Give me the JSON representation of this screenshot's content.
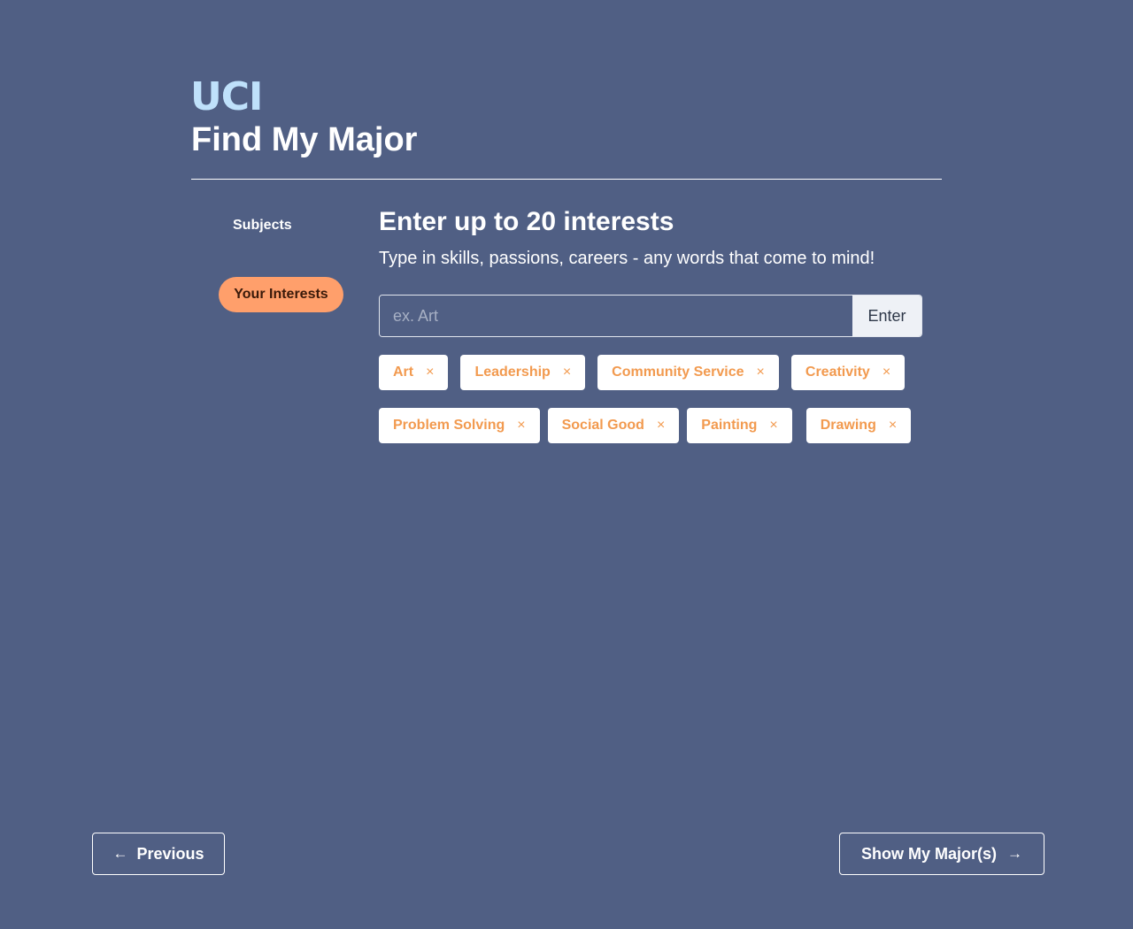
{
  "header": {
    "logo_text": "UCI",
    "title": "Find My Major"
  },
  "sidebar": {
    "items": [
      {
        "label": "Subjects",
        "active": false
      },
      {
        "label": "Your Interests",
        "active": true
      }
    ]
  },
  "main": {
    "heading": "Enter up to 20 interests",
    "subheading": "Type in skills, passions, careers - any words that come to mind!",
    "input": {
      "placeholder": "ex. Art",
      "value": ""
    },
    "enter_label": "Enter",
    "remove_glyph": "×",
    "tags": [
      "Art",
      "Leadership",
      "Community Service",
      "Creativity",
      "Problem Solving",
      "Social Good",
      "Painting",
      "Drawing"
    ]
  },
  "footer": {
    "prev_label": "Previous",
    "prev_icon": "arrow-left-icon",
    "next_label": "Show My Major(s)",
    "next_icon": "arrow-right-icon"
  },
  "colors": {
    "background": "#505f84",
    "accent": "#ff9f6b",
    "tag_text": "#f29a4f",
    "logo": "#bfe1fb"
  }
}
